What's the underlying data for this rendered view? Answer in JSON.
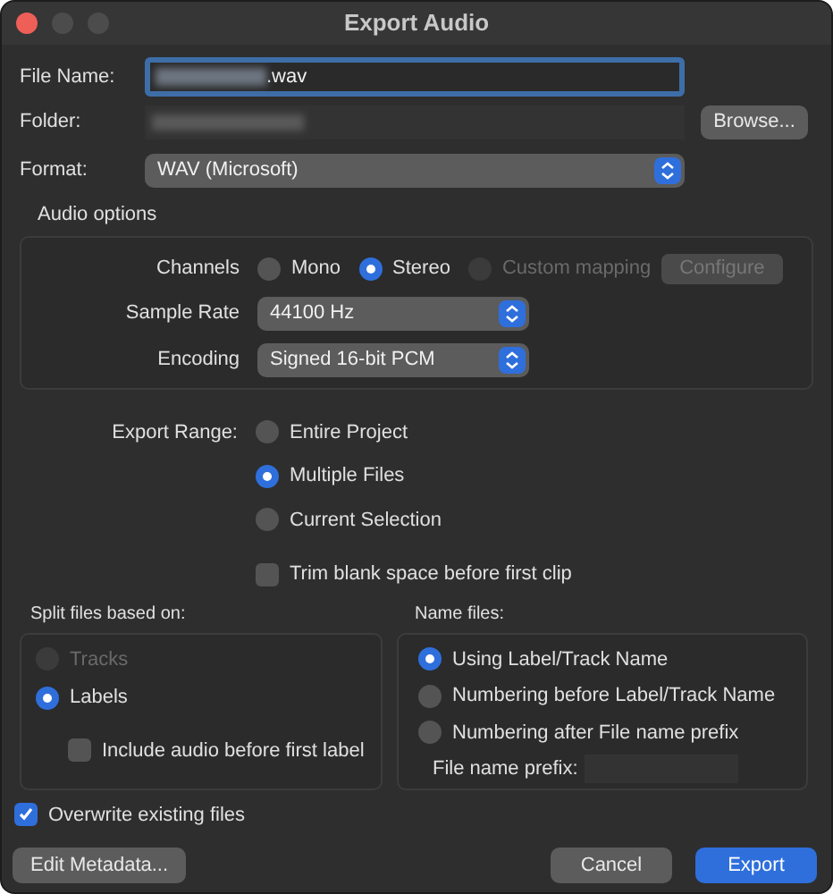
{
  "window": {
    "title": "Export Audio"
  },
  "file_name": {
    "label": "File Name:",
    "value": ".wav"
  },
  "folder": {
    "label": "Folder:",
    "button": "Browse..."
  },
  "format": {
    "label": "Format:",
    "value": "WAV (Microsoft)"
  },
  "audio_options": {
    "title": "Audio options",
    "channels": {
      "label": "Channels",
      "options": [
        {
          "label": "Mono",
          "selected": false,
          "disabled": false
        },
        {
          "label": "Stereo",
          "selected": true,
          "disabled": false
        },
        {
          "label": "Custom mapping",
          "selected": false,
          "disabled": true
        }
      ]
    },
    "configure": {
      "label": "Configure",
      "disabled": true
    },
    "sample_rate": {
      "label": "Sample Rate",
      "value": "44100 Hz"
    },
    "encoding": {
      "label": "Encoding",
      "value": "Signed 16-bit PCM"
    }
  },
  "export_range": {
    "label": "Export Range:",
    "options": [
      {
        "label": "Entire Project",
        "selected": false,
        "disabled": false
      },
      {
        "label": "Multiple Files",
        "selected": true,
        "disabled": false
      },
      {
        "label": "Current Selection",
        "selected": false,
        "disabled": false
      }
    ]
  },
  "trim": {
    "label": "Trim blank space before first clip",
    "checked": false
  },
  "split": {
    "title": "Split files based on:",
    "options": [
      {
        "label": "Tracks",
        "selected": false,
        "disabled": true
      },
      {
        "label": "Labels",
        "selected": true,
        "disabled": false
      }
    ],
    "include": {
      "label": "Include audio before first label",
      "checked": false
    }
  },
  "name_files": {
    "title": "Name files:",
    "options": [
      {
        "label": "Using Label/Track Name",
        "selected": true,
        "disabled": false
      },
      {
        "label": "Numbering before Label/Track Name",
        "selected": false,
        "disabled": false
      },
      {
        "label": "Numbering after File name prefix",
        "selected": false,
        "disabled": false
      }
    ],
    "prefix_label": "File name prefix:"
  },
  "overwrite": {
    "label": "Overwrite existing files",
    "checked": true
  },
  "left_buttons": [
    {
      "label": "Edit Metadata...",
      "kind": "secondary"
    }
  ],
  "right_buttons": [
    {
      "label": "Cancel",
      "kind": "secondary"
    },
    {
      "label": "Export",
      "kind": "primary"
    }
  ]
}
